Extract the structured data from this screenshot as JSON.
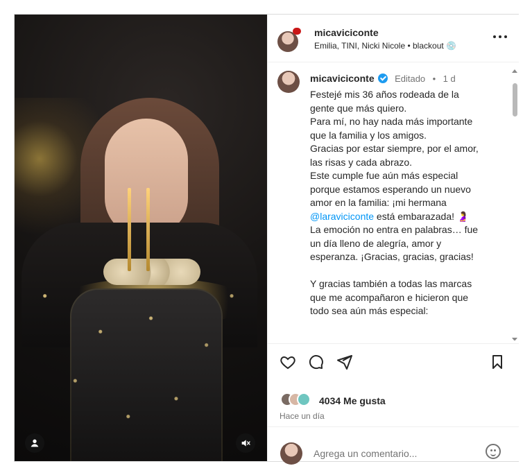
{
  "post": {
    "username": "micaviciconte",
    "audio": "Emilia, TINI, Nicki Nicole • blackout 💿",
    "more_icon": "more-horizontal-icon"
  },
  "caption": {
    "username": "micaviciconte",
    "edited": "Editado",
    "separator": "•",
    "age": "1 d",
    "body_1": "Festejé mis 36 años rodeada de la\ngente que más quiero.\nPara mí, no hay nada más importante\nque la familia y los amigos.\nGracias por estar siempre, por el amor,\nlas risas y cada abrazo.\nEste cumple fue aún más especial\nporque estamos esperando un nuevo\namor en la familia: ¡mi hermana\n",
    "mention": "@laraviciconte",
    "body_2": " está embarazada! 🤰\nLa emoción no entra en palabras… fue\nun día lleno de alegría, amor y\nesperanza. ¡Gracias, gracias, gracias!\n\nY gracias también a todas las marcas\nque me acompañaron e hicieron que\ntodo sea aún más especial:"
  },
  "actions": {
    "likes": "4034 Me gusta",
    "time": "Hace un día"
  },
  "comment_box": {
    "placeholder": "Agrega un comentario..."
  },
  "colors": {
    "link": "#0095f6",
    "verified": "#1d9bf0",
    "text": "#262626",
    "muted": "#737373",
    "border": "#dbdbdb"
  }
}
